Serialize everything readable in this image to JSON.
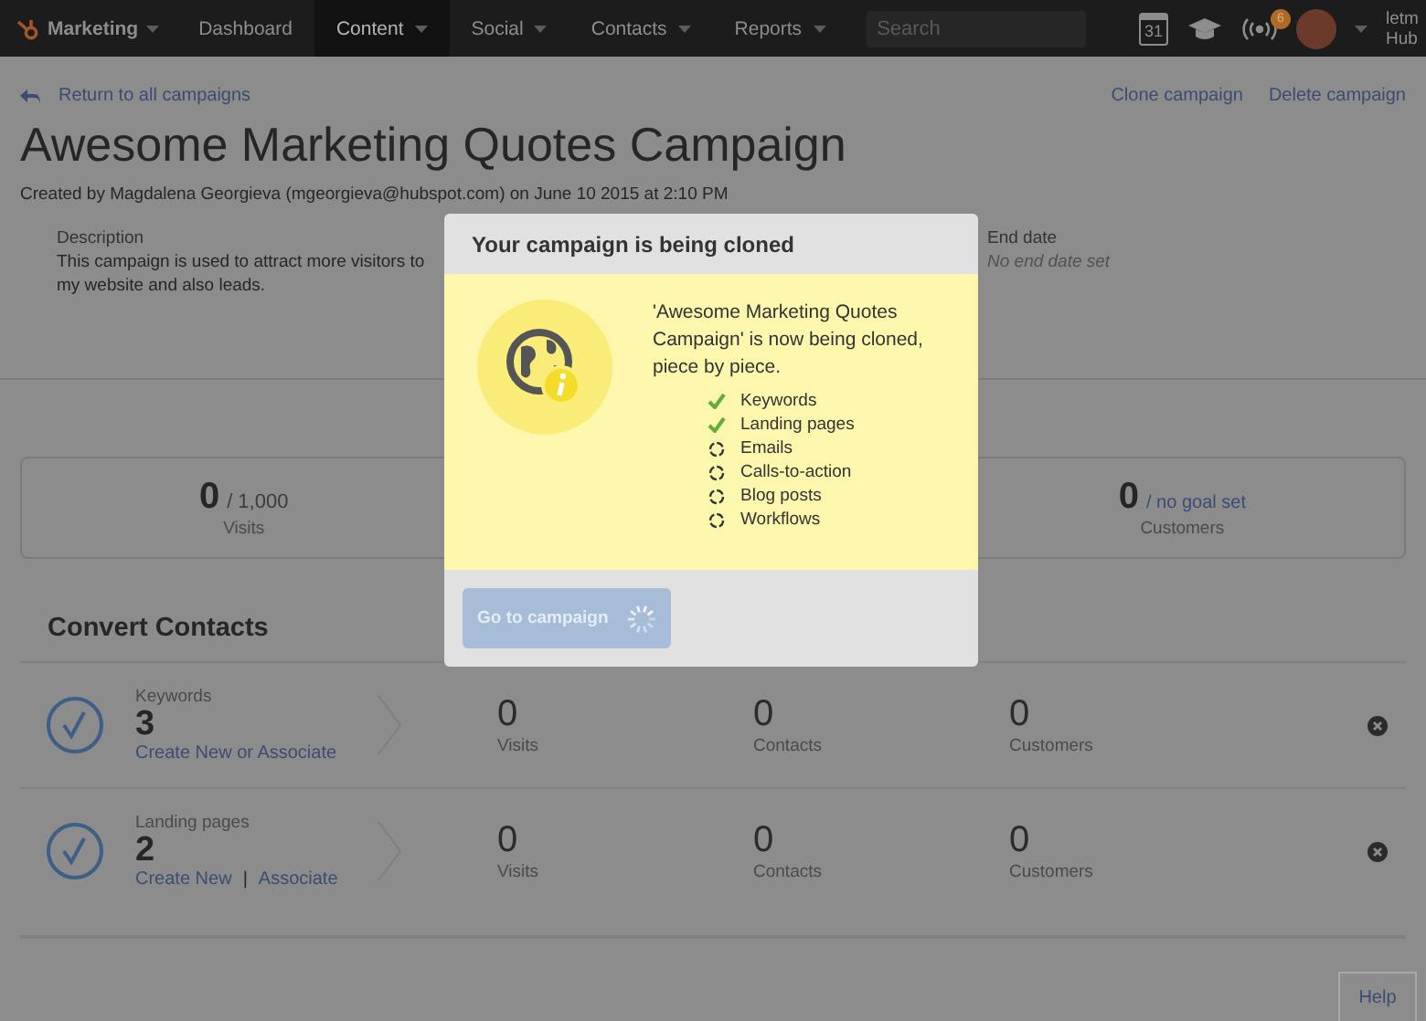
{
  "nav": {
    "brand": "Marketing",
    "items": [
      {
        "label": "Dashboard",
        "selected": false,
        "has_menu": false
      },
      {
        "label": "Content",
        "selected": true,
        "has_menu": true
      },
      {
        "label": "Social",
        "selected": false,
        "has_menu": true
      },
      {
        "label": "Contacts",
        "selected": false,
        "has_menu": true
      },
      {
        "label": "Reports",
        "selected": false,
        "has_menu": true
      }
    ],
    "search": {
      "placeholder": "Search"
    },
    "calendar_day": "31",
    "notification_count": "6",
    "user_lines": [
      "letm",
      "Hub"
    ]
  },
  "header": {
    "back_link": "Return to all campaigns",
    "actions": [
      "Clone campaign",
      "Delete campaign"
    ],
    "title": "Awesome Marketing Quotes Campaign",
    "byline": "Created by Magdalena Georgieva (mgeorgieva@hubspot.com) on June 10 2015 at 2:10 PM"
  },
  "details": [
    {
      "label": "Description",
      "value": "This campaign is used to attract more visitors to my website and also leads.",
      "muted": false
    },
    {
      "label": "End date",
      "value": "No end date set",
      "muted": true
    }
  ],
  "goals": [
    {
      "value": "0",
      "target": "/ 1,000",
      "target_link": false,
      "label": "Visits"
    },
    {
      "value": "0",
      "target": "/ no goal set",
      "target_link": true,
      "label": "Customers"
    }
  ],
  "convert": {
    "title": "Convert Contacts",
    "rows": [
      {
        "label": "Keywords",
        "count": "3",
        "links": [
          "Create New or Associate"
        ],
        "separator": "",
        "stats": [
          {
            "value": "0",
            "label": "Visits"
          },
          {
            "value": "0",
            "label": "Contacts"
          },
          {
            "value": "0",
            "label": "Customers"
          }
        ]
      },
      {
        "label": "Landing pages",
        "count": "2",
        "links": [
          "Create New",
          "Associate"
        ],
        "separator": "|",
        "stats": [
          {
            "value": "0",
            "label": "Visits"
          },
          {
            "value": "0",
            "label": "Contacts"
          },
          {
            "value": "0",
            "label": "Customers"
          }
        ]
      }
    ]
  },
  "modal": {
    "title": "Your campaign is being cloned",
    "message": "'Awesome Marketing Quotes Campaign' is now being cloned, piece by piece.",
    "steps": [
      {
        "label": "Keywords",
        "done": true
      },
      {
        "label": "Landing pages",
        "done": true
      },
      {
        "label": "Emails",
        "done": false
      },
      {
        "label": "Calls-to-action",
        "done": false
      },
      {
        "label": "Blog posts",
        "done": false
      },
      {
        "label": "Workflows",
        "done": false
      }
    ],
    "button": {
      "label": "Go to campaign",
      "disabled": true
    }
  },
  "help": "Help"
}
